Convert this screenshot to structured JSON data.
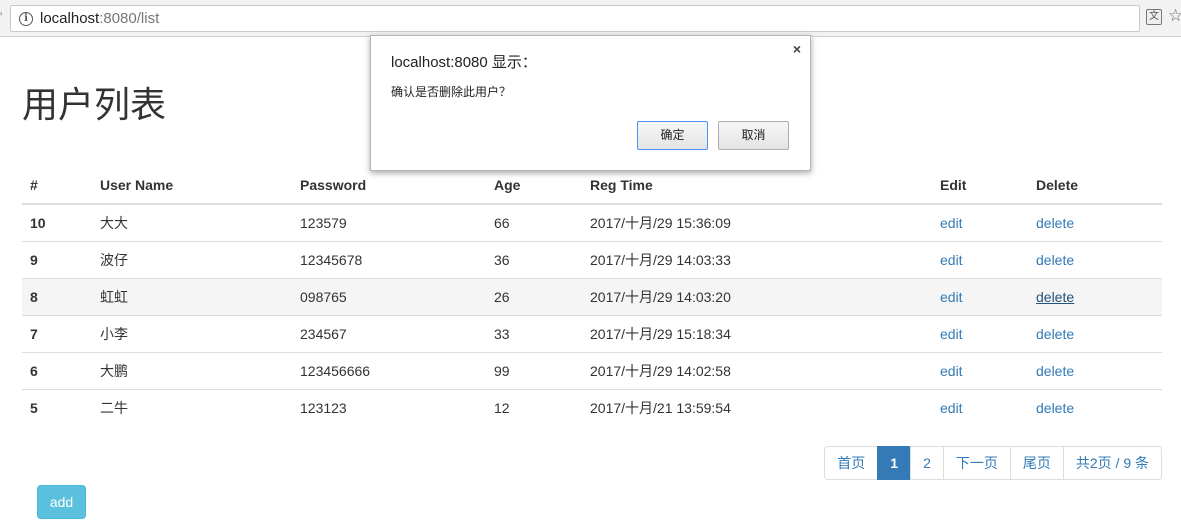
{
  "browser": {
    "url_host": "localhost",
    "url_path": ":8080/list",
    "translate_icon": "translate-icon",
    "star_icon": "bookmark-star-icon"
  },
  "page": {
    "title": "用户列表"
  },
  "table": {
    "headers": [
      "#",
      "User Name",
      "Password",
      "Age",
      "Reg Time",
      "Edit",
      "Delete"
    ],
    "rows": [
      {
        "id": "10",
        "name": "大大",
        "password": "123579",
        "age": "66",
        "time": "2017/十月/29 15:36:09",
        "edit": "edit",
        "delete": "delete"
      },
      {
        "id": "9",
        "name": "波仔",
        "password": "12345678",
        "age": "36",
        "time": "2017/十月/29 14:03:33",
        "edit": "edit",
        "delete": "delete"
      },
      {
        "id": "8",
        "name": "虹虹",
        "password": "098765",
        "age": "26",
        "time": "2017/十月/29 14:03:20",
        "edit": "edit",
        "delete": "delete"
      },
      {
        "id": "7",
        "name": "小李",
        "password": "234567",
        "age": "33",
        "time": "2017/十月/29 15:18:34",
        "edit": "edit",
        "delete": "delete"
      },
      {
        "id": "6",
        "name": "大鹏",
        "password": "123456666",
        "age": "99",
        "time": "2017/十月/29 14:02:58",
        "edit": "edit",
        "delete": "delete"
      },
      {
        "id": "5",
        "name": "二牛",
        "password": "123123",
        "age": "12",
        "time": "2017/十月/21 13:59:54",
        "edit": "edit",
        "delete": "delete"
      }
    ]
  },
  "pagination": {
    "first": "首页",
    "page1": "1",
    "page2": "2",
    "next": "下一页",
    "last": "尾页",
    "summary": "共2页 / 9 条"
  },
  "add_button": "add",
  "dialog": {
    "title": "localhost:8080 显示：",
    "message": "确认是否删除此用户？",
    "ok": "确定",
    "cancel": "取消",
    "close": "×"
  },
  "colors": {
    "link": "#337ab7",
    "active_page": "#337ab7",
    "add_button": "#5bc0de"
  }
}
